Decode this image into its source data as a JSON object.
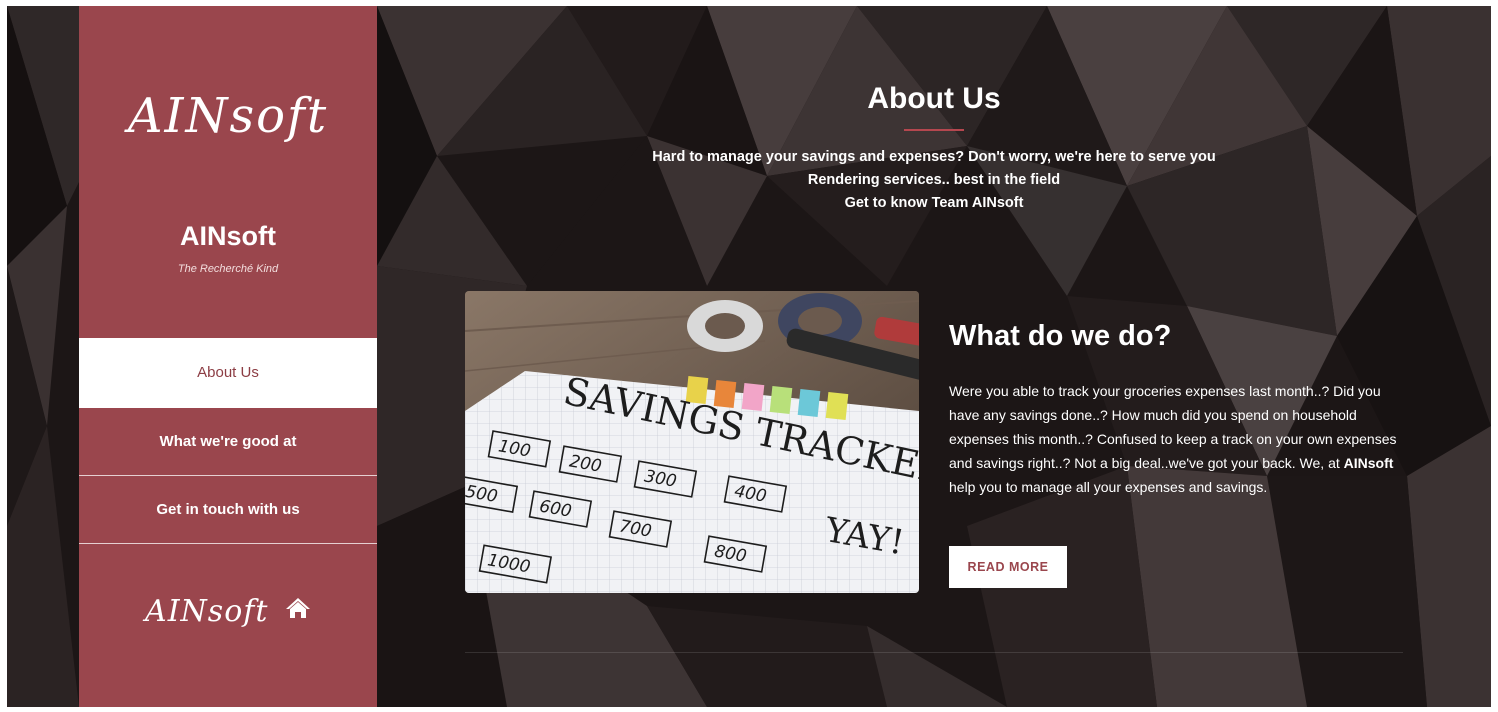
{
  "sidebar": {
    "logo_text": "AINsoft",
    "brand_name": "AINsoft",
    "tagline": "The Recherché Kind",
    "nav": [
      {
        "label": "About Us",
        "active": true
      },
      {
        "label": "What we're good at",
        "active": false
      },
      {
        "label": "Get in touch with us",
        "active": false
      }
    ],
    "home_logo_text": "AINsoft",
    "home_icon": "home-icon"
  },
  "main": {
    "title": "About Us",
    "intro_lines": [
      "Hard to manage your savings and expenses? Don't worry, we're here to serve you",
      "Rendering services.. best in the field",
      "Get to know Team AINsoft"
    ],
    "section": {
      "title": "What do we do?",
      "body_before": "Were you able to track your groceries expenses last month..? Did you have any savings done..? How much did you spend on household expenses this month..? Confused to keep a track on your own expenses and savings right..? Not a big deal..we've got your back. We, at ",
      "body_brand": "AINsoft",
      "body_after": " help you to manage all your expenses and savings.",
      "read_more": "READ MORE"
    },
    "photo": {
      "heading": "SAVINGS TRACKER",
      "cells": [
        "100",
        "200",
        "300",
        "400",
        "500",
        "600",
        "700",
        "800",
        "1000"
      ],
      "yay": "YAY!"
    }
  },
  "colors": {
    "sidebar_bg": "#9a464d",
    "accent": "#b5474f",
    "page_bg": "#1a1414"
  }
}
